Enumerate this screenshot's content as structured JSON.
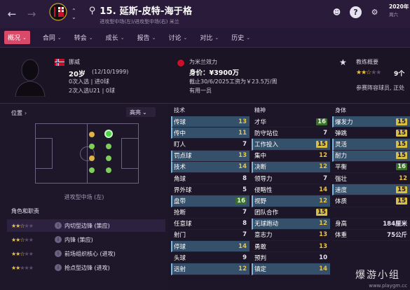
{
  "header": {
    "player_title": "15. 延斯-皮特-海于格",
    "player_sub": "进攻型中场(左)/进攻型中场(右) 米兰",
    "date": "2020年",
    "date_sub": "周六"
  },
  "tabs": [
    {
      "label": "概况",
      "active": true
    },
    {
      "label": "合同"
    },
    {
      "label": "转会"
    },
    {
      "label": "成长"
    },
    {
      "label": "报告"
    },
    {
      "label": "讨论"
    },
    {
      "label": "对比"
    },
    {
      "label": "历史"
    }
  ],
  "profile": {
    "nation": "挪威",
    "age": "20岁",
    "dob": "(12/10/1999)",
    "caps": "0次入选 | 进0球",
    "u21": "2次入选U21 | 0球",
    "club_line": "为米兰效力",
    "value": "身价：¥3900万",
    "contract": "截止30/6/2025工资为￥23.5万/周",
    "squad": "有用一员",
    "coach_title": "教练概要",
    "coach_sub": "参赛阵容球员, 正处",
    "coach_rating_stars": 2.5,
    "coach_age": "9个"
  },
  "left": {
    "position_label": "位置",
    "dropdown": "高亮",
    "pitch_caption": "进攻型中场 (左)",
    "roles_title": "角色和职责",
    "roles": [
      {
        "stars": 2.5,
        "label": "内切型边锋 (策应)",
        "selected": true
      },
      {
        "stars": 2.5,
        "label": "内锋 (策应)"
      },
      {
        "stars": 2.5,
        "label": "前场组织核心 (进攻)"
      },
      {
        "stars": 2,
        "label": "抢点型边锋 (进攻)"
      }
    ]
  },
  "attributes": {
    "technical": {
      "title": "技术",
      "rows": [
        {
          "name": "传球",
          "value": "13",
          "hl": true
        },
        {
          "name": "传中",
          "value": "11",
          "hl": true
        },
        {
          "name": "盯人",
          "value": "7"
        },
        {
          "name": "罚点球",
          "value": "13",
          "hl": true
        },
        {
          "name": "技术",
          "value": "14",
          "hl": true
        },
        {
          "name": "角球",
          "value": "8"
        },
        {
          "name": "界外球",
          "value": "5"
        },
        {
          "name": "盘带",
          "value": "16",
          "hl": true
        },
        {
          "name": "抢断",
          "value": "7"
        },
        {
          "name": "任意球",
          "value": "8"
        },
        {
          "name": "射门",
          "value": "7"
        },
        {
          "name": "停球",
          "value": "14",
          "hl": true
        },
        {
          "name": "头球",
          "value": "9"
        },
        {
          "name": "远射",
          "value": "12",
          "hl": true
        }
      ]
    },
    "mental": {
      "title": "精神",
      "rows": [
        {
          "name": "才华",
          "value": "16"
        },
        {
          "name": "防守站位",
          "value": "7"
        },
        {
          "name": "工作投入",
          "value": "15",
          "hl": true
        },
        {
          "name": "集中",
          "value": "12"
        },
        {
          "name": "决断",
          "value": "12",
          "hl": true
        },
        {
          "name": "领导力",
          "value": "7"
        },
        {
          "name": "侵略性",
          "value": "14"
        },
        {
          "name": "视野",
          "value": "12",
          "hl": true
        },
        {
          "name": "团队合作",
          "value": "15"
        },
        {
          "name": "无球跑动",
          "value": "12",
          "hl": true
        },
        {
          "name": "意志力",
          "value": "13"
        },
        {
          "name": "勇敢",
          "value": "13"
        },
        {
          "name": "预判",
          "value": "10"
        },
        {
          "name": "镇定",
          "value": "14",
          "hl": true
        }
      ]
    },
    "physical": {
      "title": "身体",
      "rows": [
        {
          "name": "爆发力",
          "value": "15",
          "hl": true
        },
        {
          "name": "弹跳",
          "value": "15"
        },
        {
          "name": "灵活",
          "value": "15",
          "hl": true
        },
        {
          "name": "耐力",
          "value": "15",
          "hl": true
        },
        {
          "name": "平衡",
          "value": "16"
        },
        {
          "name": "强壮",
          "value": "12"
        },
        {
          "name": "速度",
          "value": "15",
          "hl": true
        },
        {
          "name": "体质",
          "value": "15"
        },
        {
          "name": "",
          "value": ""
        },
        {
          "name": "身高",
          "value": "184厘米"
        },
        {
          "name": "体重",
          "value": "75公斤"
        }
      ]
    }
  },
  "watermark": "www.playgm.cc",
  "watermark_big": "爆游小组",
  "colors": {
    "accent": "#d94a6a",
    "highlight_row": "#35506a",
    "gold": "#e8c24a",
    "green": "#7ecf5a"
  }
}
